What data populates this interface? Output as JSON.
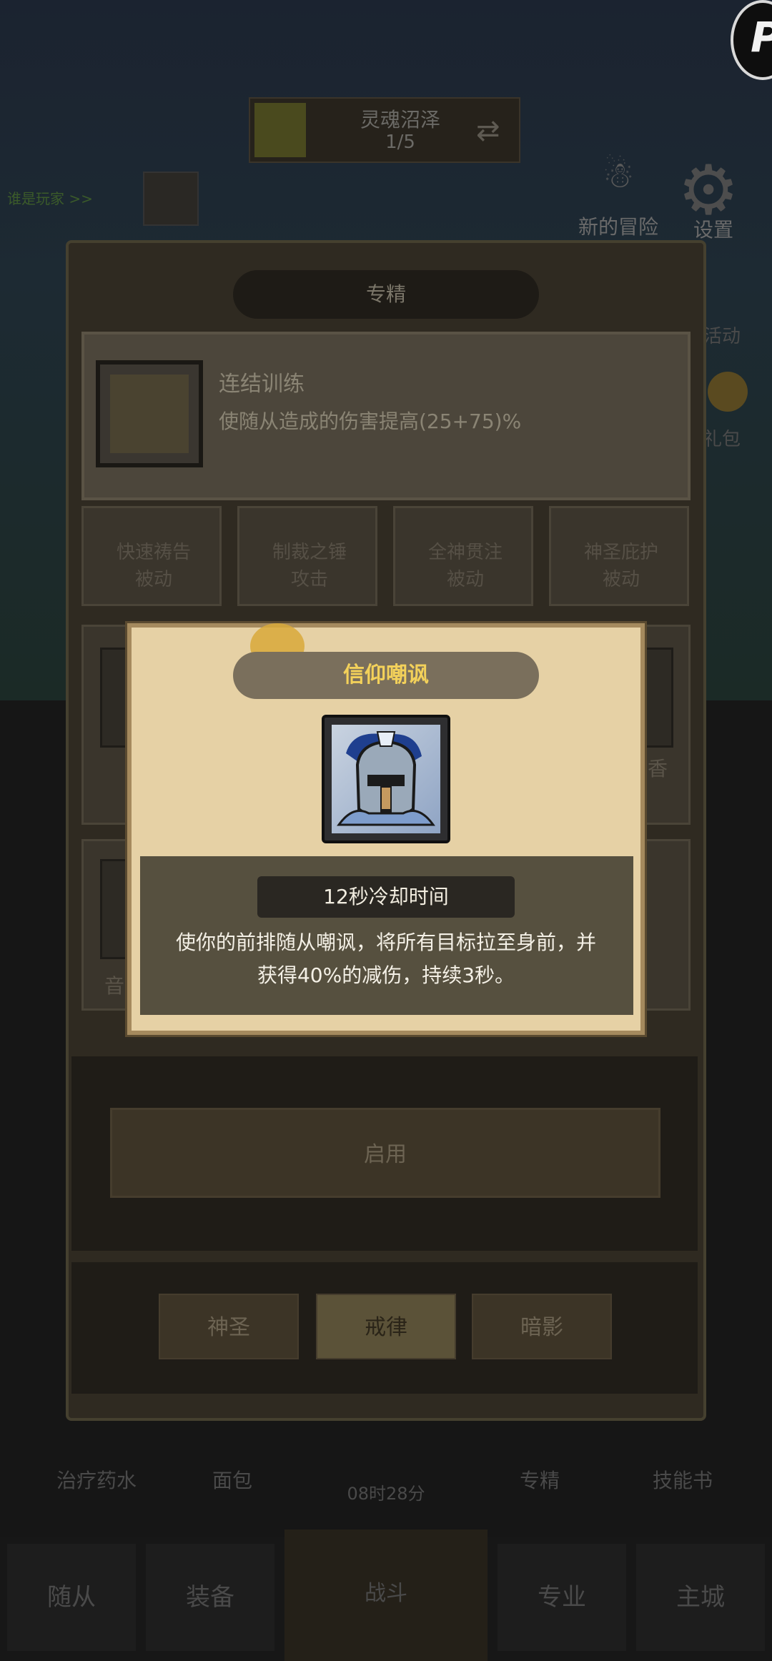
{
  "background": {
    "stage": {
      "title": "灵魂沼泽",
      "progress": "1/5"
    },
    "left_link": "谁是玩家 >>",
    "top_buttons": [
      {
        "label": "新的冒险"
      },
      {
        "label": "设置"
      }
    ],
    "side_labels": [
      "活动",
      "礼包"
    ],
    "bottom_items": [
      "治疗药水",
      "面包",
      "专精",
      "技能书"
    ],
    "timer_text": "08时28分",
    "nav": [
      "随从",
      "装备",
      "战斗",
      "专业",
      "主城"
    ]
  },
  "panel": {
    "header": "专精",
    "selected": {
      "name": "连结训练",
      "description": "使随从造成的伤害提高(25+75)%"
    },
    "talents_row1": [
      {
        "name": "快速祷告",
        "type": "被动"
      },
      {
        "name": "制裁之锤",
        "type": "攻击"
      },
      {
        "name": "全神贯注",
        "type": "被动"
      },
      {
        "name": "神圣庇护",
        "type": "被动"
      }
    ],
    "row2_right_label": "香",
    "row3_left_label": "音",
    "enable_button": "启用",
    "tabs": [
      {
        "label": "神圣",
        "active": false
      },
      {
        "label": "戒律",
        "active": true
      },
      {
        "label": "暗影",
        "active": false
      }
    ]
  },
  "popup": {
    "title": "信仰嘲讽",
    "icon": "knight-helmet-icon",
    "cooldown": "12秒冷却时间",
    "description_line1": "使你的前排随从嘲讽，将所有目标拉至身前，并",
    "description_line2": "获得40%的减伤，持续3秒。"
  },
  "colors": {
    "title_gold": "#f3d15a",
    "popup_bg": "#e6d1a5",
    "overlay": "#141414"
  }
}
